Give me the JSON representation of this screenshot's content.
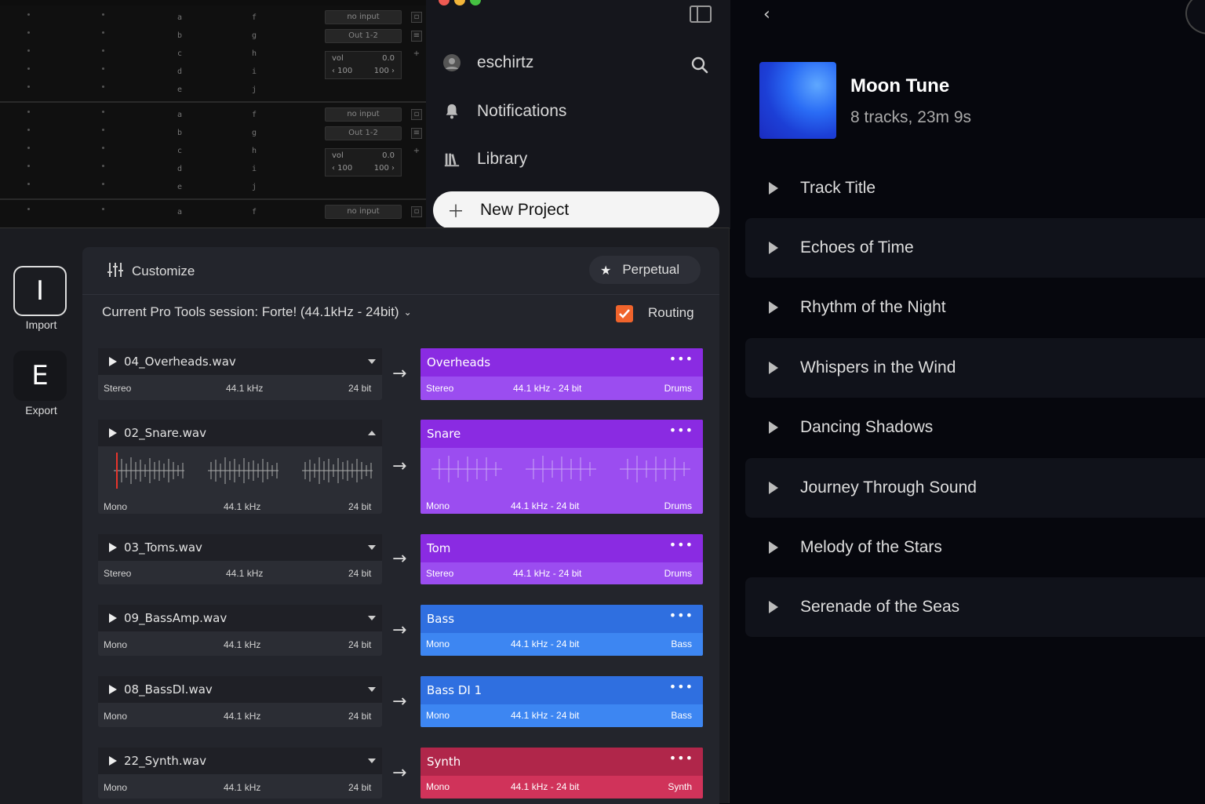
{
  "mixer": {
    "strips": [
      {
        "input": "no input",
        "output": "Out 1-2",
        "vol_label": "vol",
        "vol_value": "0.0",
        "pan_left": "‹ 100",
        "pan_right": "100 ›",
        "letters_a": [
          "a",
          "b",
          "c",
          "d",
          "e"
        ],
        "letters_b": [
          "f",
          "g",
          "h",
          "i",
          "j"
        ]
      },
      {
        "input": "no input",
        "output": "Out 1-2",
        "vol_label": "vol",
        "vol_value": "0.0",
        "pan_left": "‹ 100",
        "pan_right": "100 ›",
        "letters_a": [
          "a",
          "b",
          "c",
          "d",
          "e"
        ],
        "letters_b": [
          "f",
          "g",
          "h",
          "i",
          "j"
        ]
      },
      {
        "input": "no input",
        "letters_a": [
          "a"
        ],
        "letters_b": [
          "f"
        ]
      }
    ]
  },
  "sidebar": {
    "user": "eschirtz",
    "notifications": "Notifications",
    "library": "Library",
    "new_project": "New Project"
  },
  "playlist": {
    "title": "Moon Tune",
    "subtitle": "8 tracks, 23m 9s",
    "tracks": [
      "Track Title",
      "Echoes of Time",
      "Rhythm of the Night",
      "Whispers in the Wind",
      "Dancing Shadows",
      "Journey Through Sound",
      "Melody of the Stars",
      "Serenade of the Seas"
    ]
  },
  "nav": {
    "import_letter": "I",
    "import_label": "Import",
    "export_letter": "E",
    "export_label": "Export"
  },
  "toolbar": {
    "customize": "Customize",
    "license": "Perpetual"
  },
  "session": {
    "label": "Current Pro Tools session: Forte! (44.1kHz - 24bit)",
    "routing_label": "Routing",
    "routing_checked": true
  },
  "rows": [
    {
      "file": "04_Overheads.wav",
      "channels": "Stereo",
      "rate": "44.1 kHz",
      "bits": "24 bit",
      "expanded": false,
      "dest": "Overheads",
      "dest_channels": "Stereo",
      "dest_format": "44.1 kHz - 24 bit",
      "dest_group": "Drums",
      "color": "#8a2be2"
    },
    {
      "file": "02_Snare.wav",
      "channels": "Mono",
      "rate": "44.1 kHz",
      "bits": "24 bit",
      "expanded": true,
      "dest": "Snare",
      "dest_channels": "Mono",
      "dest_format": "44.1 kHz - 24 bit",
      "dest_group": "Drums",
      "color": "#8a2be2"
    },
    {
      "file": "03_Toms.wav",
      "channels": "Stereo",
      "rate": "44.1 kHz",
      "bits": "24 bit",
      "expanded": false,
      "dest": "Tom",
      "dest_channels": "Stereo",
      "dest_format": "44.1 kHz - 24 bit",
      "dest_group": "Drums",
      "color": "#8a2be2"
    },
    {
      "file": "09_BassAmp.wav",
      "channels": "Mono",
      "rate": "44.1 kHz",
      "bits": "24 bit",
      "expanded": false,
      "dest": "Bass",
      "dest_channels": "Mono",
      "dest_format": "44.1 kHz - 24 bit",
      "dest_group": "Bass",
      "color": "#2f6fe0"
    },
    {
      "file": "08_BassDI.wav",
      "channels": "Mono",
      "rate": "44.1 kHz",
      "bits": "24 bit",
      "expanded": false,
      "dest": "Bass DI 1",
      "dest_channels": "Mono",
      "dest_format": "44.1 kHz - 24 bit",
      "dest_group": "Bass",
      "color": "#2f6fe0"
    },
    {
      "file": "22_Synth.wav",
      "channels": "Mono",
      "rate": "44.1 kHz",
      "bits": "24 bit",
      "expanded": false,
      "dest": "Synth",
      "dest_channels": "Mono",
      "dest_format": "44.1 kHz - 24 bit",
      "dest_group": "Synth",
      "color": "#b0264a"
    }
  ],
  "colors": {
    "accent_checkbox": "#f0642c"
  }
}
